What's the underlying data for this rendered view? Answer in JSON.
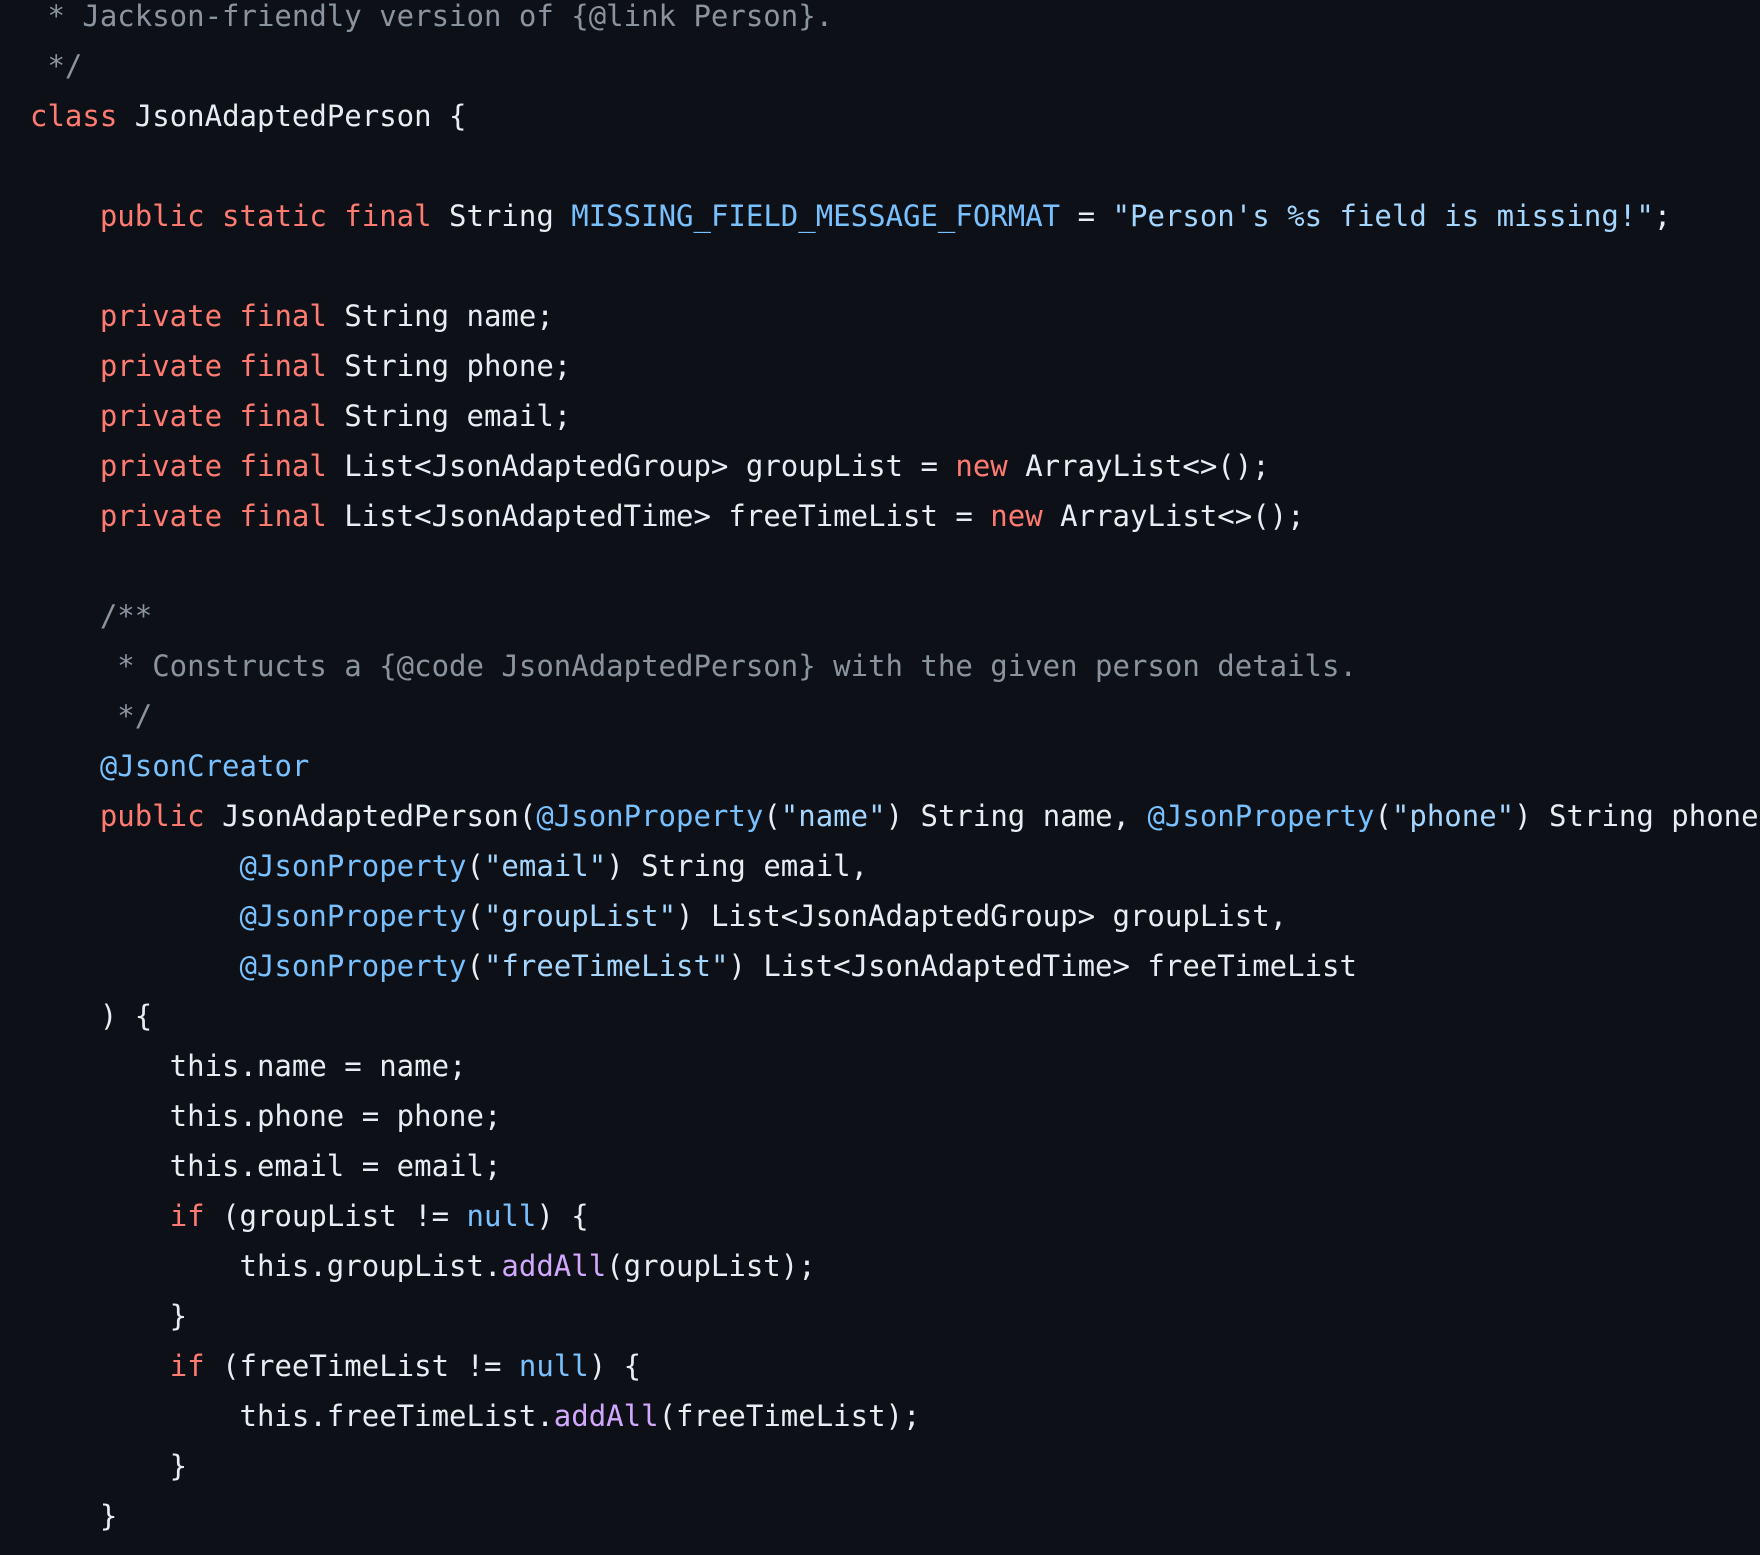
{
  "code": {
    "language": "java",
    "lines": [
      [
        {
          "t": "comment",
          "v": " * Jackson-friendly version of {@link Person}."
        }
      ],
      [
        {
          "t": "comment",
          "v": " */"
        }
      ],
      [
        {
          "t": "keyword",
          "v": "class"
        },
        {
          "t": "plain",
          "v": " JsonAdaptedPerson {"
        }
      ],
      [],
      [
        {
          "t": "plain",
          "v": "    "
        },
        {
          "t": "keyword",
          "v": "public static final"
        },
        {
          "t": "plain",
          "v": " String "
        },
        {
          "t": "constant",
          "v": "MISSING_FIELD_MESSAGE_FORMAT"
        },
        {
          "t": "plain",
          "v": " = "
        },
        {
          "t": "string",
          "v": "\"Person's %s field is missing!\""
        },
        {
          "t": "plain",
          "v": ";"
        }
      ],
      [],
      [
        {
          "t": "plain",
          "v": "    "
        },
        {
          "t": "keyword",
          "v": "private final"
        },
        {
          "t": "plain",
          "v": " String name;"
        }
      ],
      [
        {
          "t": "plain",
          "v": "    "
        },
        {
          "t": "keyword",
          "v": "private final"
        },
        {
          "t": "plain",
          "v": " String phone;"
        }
      ],
      [
        {
          "t": "plain",
          "v": "    "
        },
        {
          "t": "keyword",
          "v": "private final"
        },
        {
          "t": "plain",
          "v": " String email;"
        }
      ],
      [
        {
          "t": "plain",
          "v": "    "
        },
        {
          "t": "keyword",
          "v": "private final"
        },
        {
          "t": "plain",
          "v": " List<JsonAdaptedGroup> groupList = "
        },
        {
          "t": "keyword",
          "v": "new"
        },
        {
          "t": "plain",
          "v": " ArrayList<>();"
        }
      ],
      [
        {
          "t": "plain",
          "v": "    "
        },
        {
          "t": "keyword",
          "v": "private final"
        },
        {
          "t": "plain",
          "v": " List<JsonAdaptedTime> freeTimeList = "
        },
        {
          "t": "keyword",
          "v": "new"
        },
        {
          "t": "plain",
          "v": " ArrayList<>();"
        }
      ],
      [],
      [
        {
          "t": "comment",
          "v": "    /**"
        }
      ],
      [
        {
          "t": "comment",
          "v": "     * Constructs a {@code JsonAdaptedPerson} with the given person details."
        }
      ],
      [
        {
          "t": "comment",
          "v": "     */"
        }
      ],
      [
        {
          "t": "plain",
          "v": "    "
        },
        {
          "t": "annotation",
          "v": "@JsonCreator"
        }
      ],
      [
        {
          "t": "plain",
          "v": "    "
        },
        {
          "t": "keyword",
          "v": "public"
        },
        {
          "t": "plain",
          "v": " JsonAdaptedPerson("
        },
        {
          "t": "annotation",
          "v": "@JsonProperty"
        },
        {
          "t": "plain",
          "v": "("
        },
        {
          "t": "string",
          "v": "\"name\""
        },
        {
          "t": "plain",
          "v": ") String name, "
        },
        {
          "t": "annotation",
          "v": "@JsonProperty"
        },
        {
          "t": "plain",
          "v": "("
        },
        {
          "t": "string",
          "v": "\"phone\""
        },
        {
          "t": "plain",
          "v": ") String phone,"
        }
      ],
      [
        {
          "t": "plain",
          "v": "            "
        },
        {
          "t": "annotation",
          "v": "@JsonProperty"
        },
        {
          "t": "plain",
          "v": "("
        },
        {
          "t": "string",
          "v": "\"email\""
        },
        {
          "t": "plain",
          "v": ") String email,"
        }
      ],
      [
        {
          "t": "plain",
          "v": "            "
        },
        {
          "t": "annotation",
          "v": "@JsonProperty"
        },
        {
          "t": "plain",
          "v": "("
        },
        {
          "t": "string",
          "v": "\"groupList\""
        },
        {
          "t": "plain",
          "v": ") List<JsonAdaptedGroup> groupList,"
        }
      ],
      [
        {
          "t": "plain",
          "v": "            "
        },
        {
          "t": "annotation",
          "v": "@JsonProperty"
        },
        {
          "t": "plain",
          "v": "("
        },
        {
          "t": "string",
          "v": "\"freeTimeList\""
        },
        {
          "t": "plain",
          "v": ") List<JsonAdaptedTime> freeTimeList"
        }
      ],
      [
        {
          "t": "plain",
          "v": "    ) {"
        }
      ],
      [
        {
          "t": "plain",
          "v": "        this.name = name;"
        }
      ],
      [
        {
          "t": "plain",
          "v": "        this.phone = phone;"
        }
      ],
      [
        {
          "t": "plain",
          "v": "        this.email = email;"
        }
      ],
      [
        {
          "t": "plain",
          "v": "        "
        },
        {
          "t": "keyword",
          "v": "if"
        },
        {
          "t": "plain",
          "v": " (groupList != "
        },
        {
          "t": "constant",
          "v": "null"
        },
        {
          "t": "plain",
          "v": ") {"
        }
      ],
      [
        {
          "t": "plain",
          "v": "            this.groupList."
        },
        {
          "t": "method",
          "v": "addAll"
        },
        {
          "t": "plain",
          "v": "(groupList);"
        }
      ],
      [
        {
          "t": "plain",
          "v": "        }"
        }
      ],
      [
        {
          "t": "plain",
          "v": "        "
        },
        {
          "t": "keyword",
          "v": "if"
        },
        {
          "t": "plain",
          "v": " (freeTimeList != "
        },
        {
          "t": "constant",
          "v": "null"
        },
        {
          "t": "plain",
          "v": ") {"
        }
      ],
      [
        {
          "t": "plain",
          "v": "            this.freeTimeList."
        },
        {
          "t": "method",
          "v": "addAll"
        },
        {
          "t": "plain",
          "v": "(freeTimeList);"
        }
      ],
      [
        {
          "t": "plain",
          "v": "        }"
        }
      ],
      [
        {
          "t": "plain",
          "v": "    }"
        }
      ]
    ]
  }
}
